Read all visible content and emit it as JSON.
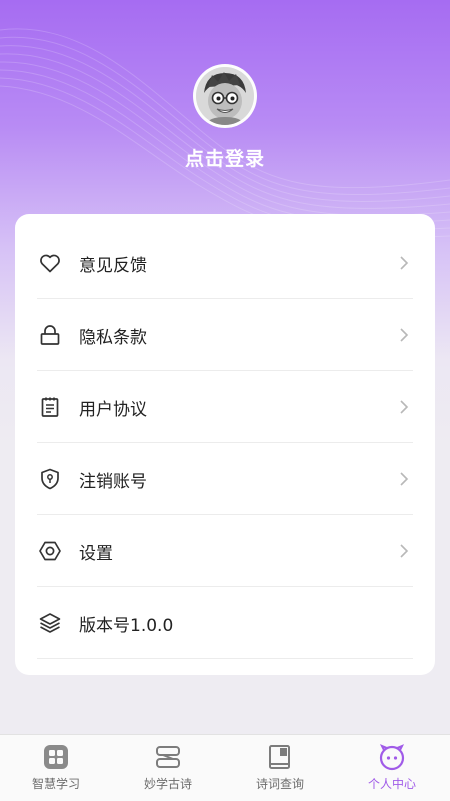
{
  "profile": {
    "login_text": "点击登录"
  },
  "menu": [
    {
      "label": "意见反馈",
      "icon": "heart-icon"
    },
    {
      "label": "隐私条款",
      "icon": "lock-icon"
    },
    {
      "label": "用户协议",
      "icon": "document-icon"
    },
    {
      "label": "注销账号",
      "icon": "shield-key-icon"
    },
    {
      "label": "设置",
      "icon": "hexagon-settings-icon"
    },
    {
      "label": "版本号1.0.0",
      "icon": "layers-icon"
    }
  ],
  "tabbar": [
    {
      "label": "智慧学习",
      "icon": "grid-icon",
      "active": false
    },
    {
      "label": "妙学古诗",
      "icon": "scroll-icon",
      "active": false
    },
    {
      "label": "诗词查询",
      "icon": "book-icon",
      "active": false
    },
    {
      "label": "个人中心",
      "icon": "face-icon",
      "active": true
    }
  ],
  "colors": {
    "accent": "#a05be8",
    "header_top": "#a66cf2",
    "background": "#eeecf2"
  }
}
